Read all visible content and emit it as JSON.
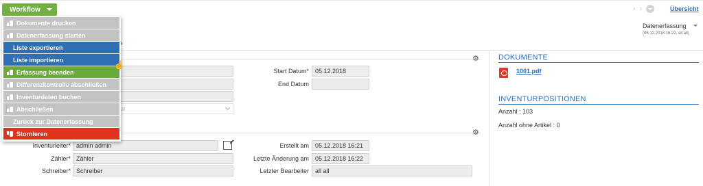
{
  "toolbar": {
    "workflow_label": "Workflow",
    "uebersicht_label": "Übersicht"
  },
  "status": {
    "title": "Datenerfassung",
    "subtitle": "(05.12.2018 16:22, all all)"
  },
  "link_fragment": "te",
  "menu": {
    "items": [
      {
        "label": "Dokumente drucken",
        "style": "grey",
        "icon": "thumbs-up-icon"
      },
      {
        "label": "Datenerfassung starten",
        "style": "grey",
        "icon": "thumbs-up-icon"
      },
      {
        "label": "Liste exportieren",
        "style": "blue",
        "icon": ""
      },
      {
        "label": "Liste importieren",
        "style": "blue",
        "icon": ""
      },
      {
        "label": "Erfassung beenden",
        "style": "green",
        "icon": "thumbs-up-icon"
      },
      {
        "label": "Differenzkontrolle abschließen",
        "style": "grey",
        "icon": "thumbs-up-icon"
      },
      {
        "label": "Inventurdaten buchen",
        "style": "grey",
        "icon": "thumbs-up-icon"
      },
      {
        "label": "Abschließen",
        "style": "grey",
        "icon": "thumbs-up-icon"
      },
      {
        "label": "Zurück zur Datenerfassung",
        "style": "grey",
        "icon": ""
      },
      {
        "label": "Stornieren",
        "style": "red",
        "icon": "thumbs-down-icon"
      }
    ]
  },
  "section1": {
    "start_label": "Start Datum*",
    "start_value": "05.12.2018",
    "end_label": "End Datum",
    "end_value": "",
    "select_placeholder": "ur"
  },
  "section2": {
    "inventurleiter_label": "Inventurleiter*",
    "inventurleiter_value": "admin admin",
    "zaehler_label": "Zähler*",
    "zaehler_value": "Zähler",
    "schreiber_label": "Schreiber*",
    "schreiber_value": "Schreiber",
    "erstellt_label": "Erstellt am",
    "erstellt_value": "05.12.2018 16:21",
    "aenderung_label": "Letzte Änderung am",
    "aenderung_value": "05.12.2018 16:22",
    "bearbeiter_label": "Letzter Bearbeiter",
    "bearbeiter_value": "all all"
  },
  "documents": {
    "title": "DOKUMENTE",
    "file": "1001.pdf"
  },
  "positions": {
    "title": "INVENTURPOSITIONEN",
    "anzahl": "Anzahl : 103",
    "ohne_artikel": "Anzahl ohne Artikel : 0"
  },
  "colors": {
    "accent": "#2a6ebb",
    "workflow": "#72b043",
    "grey_item": "#c3c3c3",
    "blue_item": "#2e6fb5",
    "green_item": "#6aaa3a",
    "red_item": "#e0321c"
  }
}
